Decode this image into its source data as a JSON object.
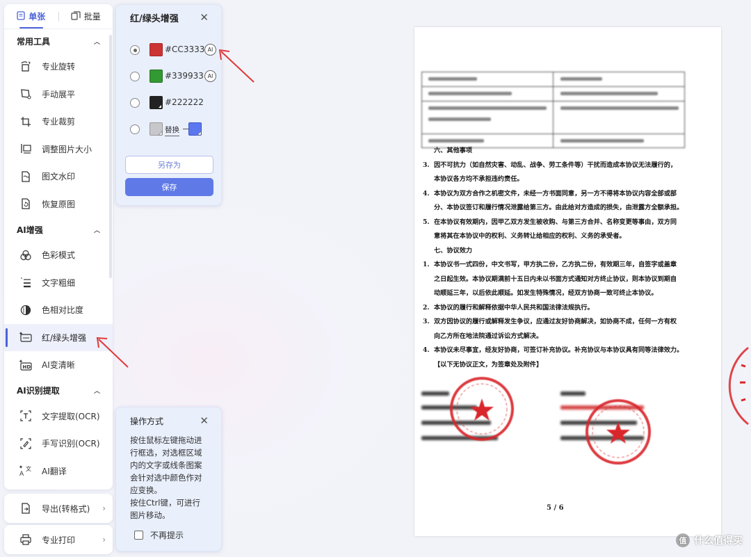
{
  "mode_tabs": [
    {
      "label": "单张",
      "active": true
    },
    {
      "label": "批量",
      "active": false
    }
  ],
  "sections": {
    "common": {
      "title": "常用工具",
      "items": [
        "专业旋转",
        "手动展平",
        "专业裁剪",
        "调整图片大小",
        "图文水印",
        "恢复原图"
      ]
    },
    "ai_enhance": {
      "title": "AI增强",
      "items": [
        "色彩模式",
        "文字粗细",
        "色相对比度",
        "红/绿头增强",
        "AI变清晰"
      ]
    },
    "ai_ocr": {
      "title": "AI识别提取",
      "items": [
        "文字提取(OCR)",
        "手写识别(OCR)",
        "AI翻译"
      ]
    }
  },
  "bottom": {
    "export": "导出(转格式)",
    "print": "专业打印"
  },
  "enhance_panel": {
    "title": "红/绿头增强",
    "colors": [
      {
        "hex": "#CC3333",
        "label": "#CC3333",
        "checked": true,
        "ai": "AI"
      },
      {
        "hex": "#339933",
        "label": "#339933",
        "checked": false,
        "ai": "AI"
      },
      {
        "hex": "#222222",
        "label": "#222222",
        "checked": false
      }
    ],
    "replace_label": "替换",
    "save_as": "另存为",
    "save": "保存"
  },
  "help_panel": {
    "title": "操作方式",
    "body_lines": [
      "按住鼠标左键拖动进",
      "行框选，对选框区域",
      "内的文字或线条图案",
      "会针对选中颜色作对",
      "应变换。",
      "按住Ctrl键，可进行",
      "图片移动。"
    ],
    "dont_show": "不再提示"
  },
  "document": {
    "lines": [
      {
        "num": "",
        "text": "六、其他事项",
        "indent": false
      },
      {
        "num": "3.",
        "text": "因不可抗力（如自然灾害、动乱、战争、劳工条件等）干扰而造成本协议无法履行的，",
        "indent": false
      },
      {
        "num": "",
        "text": "本协议各方均不承担违约责任。",
        "indent": true
      },
      {
        "num": "4.",
        "text": "本协议为双方合作之机密文件，未经一方书面同意，另一方不得将本协议内容全部或部",
        "indent": false
      },
      {
        "num": "",
        "text": "分、本协议签订和履行情况泄露给第三方。由此给对方造成的损失，由泄露方全额承担。",
        "indent": true
      },
      {
        "num": "5.",
        "text": "在本协议有效期内，因甲乙双方发生被收购、与第三方合并、名称变更等事由，双方同",
        "indent": false
      },
      {
        "num": "",
        "text": "意将其在本协议中的权利、义务转让给相应的权利、义务的承受者。",
        "indent": true
      },
      {
        "num": "",
        "text": "七、协议效力",
        "indent": false
      },
      {
        "num": "1.",
        "text": "本协议书一式四份，中文书写，甲方执二份，乙方执二份，有效期三年，自签字或盖章",
        "indent": false
      },
      {
        "num": "",
        "text": "之日起生效。本协议期满前十五日内未以书面方式通知对方终止协议，则本协议到期自",
        "indent": true
      },
      {
        "num": "",
        "text": "动顺延三年，以后依此顺延。如发生特殊情况，经双方协商一致可终止本协议。",
        "indent": true
      },
      {
        "num": "2.",
        "text": "本协议的履行和解释依据中华人民共和国法律法规执行。",
        "indent": false
      },
      {
        "num": "3.",
        "text": "双方因协议的履行或解释发生争议，应通过友好协商解决，如协商不成，任何一方有权",
        "indent": false
      },
      {
        "num": "",
        "text": "向乙方所在地法院通过诉讼方式解决。",
        "indent": true
      },
      {
        "num": "4.",
        "text": "本协议未尽事宜，经友好协商，可签订补充协议。补充协议与本协议具有同等法律效力。",
        "indent": false
      },
      {
        "num": "",
        "text": "【以下无协议正文，为签章处及附件】",
        "indent": true
      }
    ],
    "page_number": "5 / 6"
  },
  "watermark": "值 什么值得买",
  "colors": {
    "accent": "#4b62d8",
    "primary_button": "#5f7ae7",
    "panel_bg": "#e9effb",
    "arrow": "#e0383a",
    "stamp": "#d9262b"
  }
}
